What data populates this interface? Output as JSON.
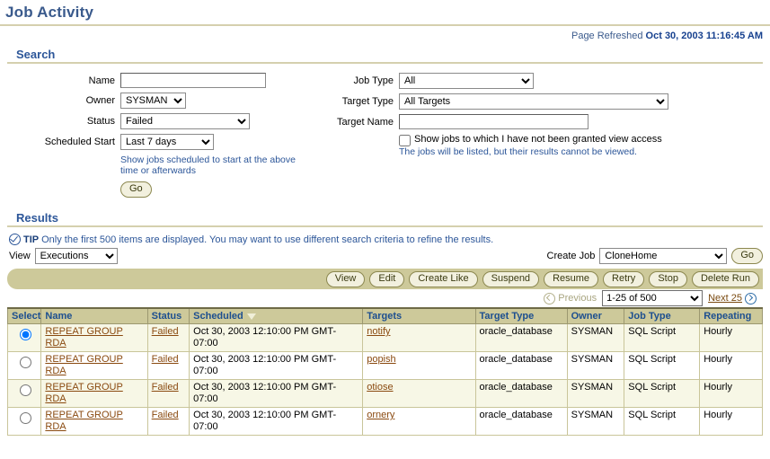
{
  "page": {
    "title": "Job Activity",
    "refresh_label": "Page Refreshed",
    "refresh_value": "Oct 30, 2003 11:16:45 AM"
  },
  "search": {
    "heading": "Search",
    "name_label": "Name",
    "name_value": "",
    "owner_label": "Owner",
    "owner_value": "SYSMAN",
    "status_label": "Status",
    "status_value": "Failed",
    "scheduled_start_label": "Scheduled Start",
    "scheduled_start_value": "Last 7 days",
    "scheduled_hint": "Show jobs scheduled to start at the above time or afterwards",
    "go_label": "Go",
    "job_type_label": "Job Type",
    "job_type_value": "All",
    "target_type_label": "Target Type",
    "target_type_value": "All Targets",
    "target_name_label": "Target Name",
    "target_name_value": "",
    "show_jobs_checkbox_label": "Show jobs to which I have not been granted view access",
    "show_jobs_checkbox_checked": false,
    "show_jobs_hint": "The jobs will be listed, but their results cannot be viewed."
  },
  "results": {
    "heading": "Results",
    "tip_word": "TIP",
    "tip_text": "Only the first 500 items are displayed. You may want to use different search criteria to refine the results.",
    "view_label": "View",
    "view_value": "Executions",
    "create_job_label": "Create Job",
    "create_job_value": "CloneHome",
    "create_job_go_label": "Go",
    "toolbar_buttons": [
      "View",
      "Edit",
      "Create Like",
      "Suspend",
      "Resume",
      "Retry",
      "Stop",
      "Delete Run"
    ],
    "pager": {
      "previous_label": "Previous",
      "range_value": "1-25 of 500",
      "next_label": "Next 25"
    },
    "columns": [
      "Select",
      "Name",
      "Status",
      "Scheduled",
      "Targets",
      "Target Type",
      "Owner",
      "Job Type",
      "Repeating"
    ],
    "sorted_column": "Scheduled",
    "sort_direction": "descending",
    "rows": [
      {
        "selected": true,
        "name": "REPEAT GROUP RDA",
        "status": "Failed",
        "scheduled": "Oct 30, 2003 12:10:00 PM GMT-07:00",
        "targets": "notify",
        "target_type": "oracle_database",
        "owner": "SYSMAN",
        "job_type": "SQL Script",
        "repeating": "Hourly"
      },
      {
        "selected": false,
        "name": "REPEAT GROUP RDA",
        "status": "Failed",
        "scheduled": "Oct 30, 2003 12:10:00 PM GMT-07:00",
        "targets": "popish",
        "target_type": "oracle_database",
        "owner": "SYSMAN",
        "job_type": "SQL Script",
        "repeating": "Hourly"
      },
      {
        "selected": false,
        "name": "REPEAT GROUP RDA",
        "status": "Failed",
        "scheduled": "Oct 30, 2003 12:10:00 PM GMT-07:00",
        "targets": "otiose",
        "target_type": "oracle_database",
        "owner": "SYSMAN",
        "job_type": "SQL Script",
        "repeating": "Hourly"
      },
      {
        "selected": false,
        "name": "REPEAT GROUP RDA",
        "status": "Failed",
        "scheduled": "Oct 30, 2003 12:10:00 PM GMT-07:00",
        "targets": "ornery",
        "target_type": "oracle_database",
        "owner": "SYSMAN",
        "job_type": "SQL Script",
        "repeating": "Hourly"
      }
    ]
  },
  "colors": {
    "title_blue": "#3a5a8c",
    "rule_tan": "#d5d0ae",
    "header_khaki": "#cdc99a",
    "row_cream": "#f7f7e6",
    "link_brown": "#8a4a10",
    "hint_blue": "#2c5699"
  }
}
